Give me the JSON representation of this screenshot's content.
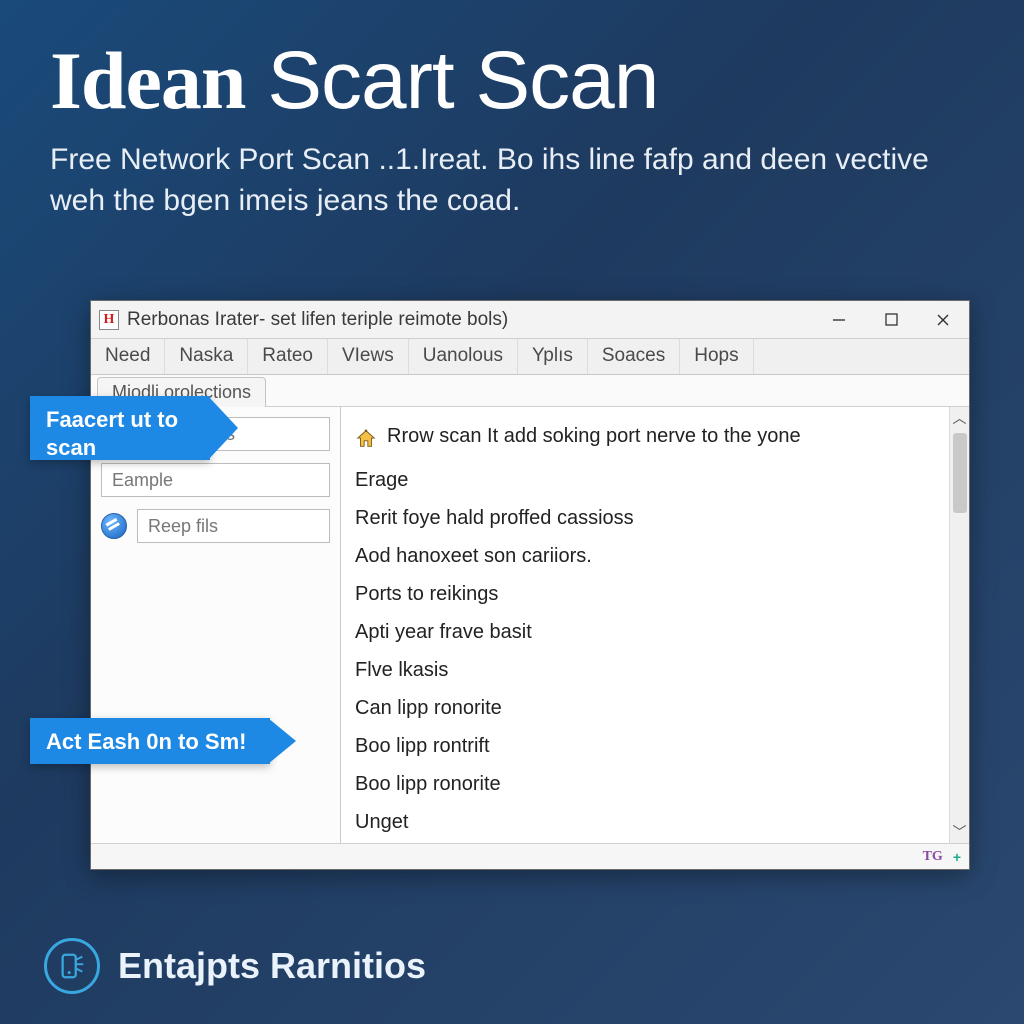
{
  "hero": {
    "title_bold": "Idean",
    "title_light": "Scart Scan",
    "subtitle": "Free Network Port Scan ..1.Ireat. Bo ihs line fafp and deen vective weh the bgen imeis jeans the coad."
  },
  "window": {
    "icon_letter": "H",
    "title": "Rerbonas Irater- set lifen teriple reimote bols)",
    "menu": [
      "Need",
      "Naska",
      "Rateo",
      "VIews",
      "Uanolous",
      "Yplıs",
      "Soaces",
      "Hops"
    ],
    "subtab": "Miodli orolections",
    "sidebar": {
      "field_mpass": "mpass",
      "field_eample": "Eample",
      "reep_label": "Reep fils"
    },
    "content": {
      "lead": "Rrow scan It add soking port nerve to the yone",
      "lines": [
        "Erage",
        "Rerit foye hald proffed cassioss",
        "Aod hanoxeet son cariiors.",
        "Ports to reikings",
        "Apti year frave basit",
        "Flve lkasis",
        "Can lipp ronorite",
        "Boo lipp rontrift",
        "Boo lipp ronorite",
        "Unget"
      ]
    },
    "status": {
      "tg": "TG",
      "plus": "+"
    }
  },
  "callouts": {
    "one": "Faacert ut to scan",
    "two": "Act Eash 0n to Sm!"
  },
  "footer": {
    "brand": "Entajpts Rarnitios"
  }
}
